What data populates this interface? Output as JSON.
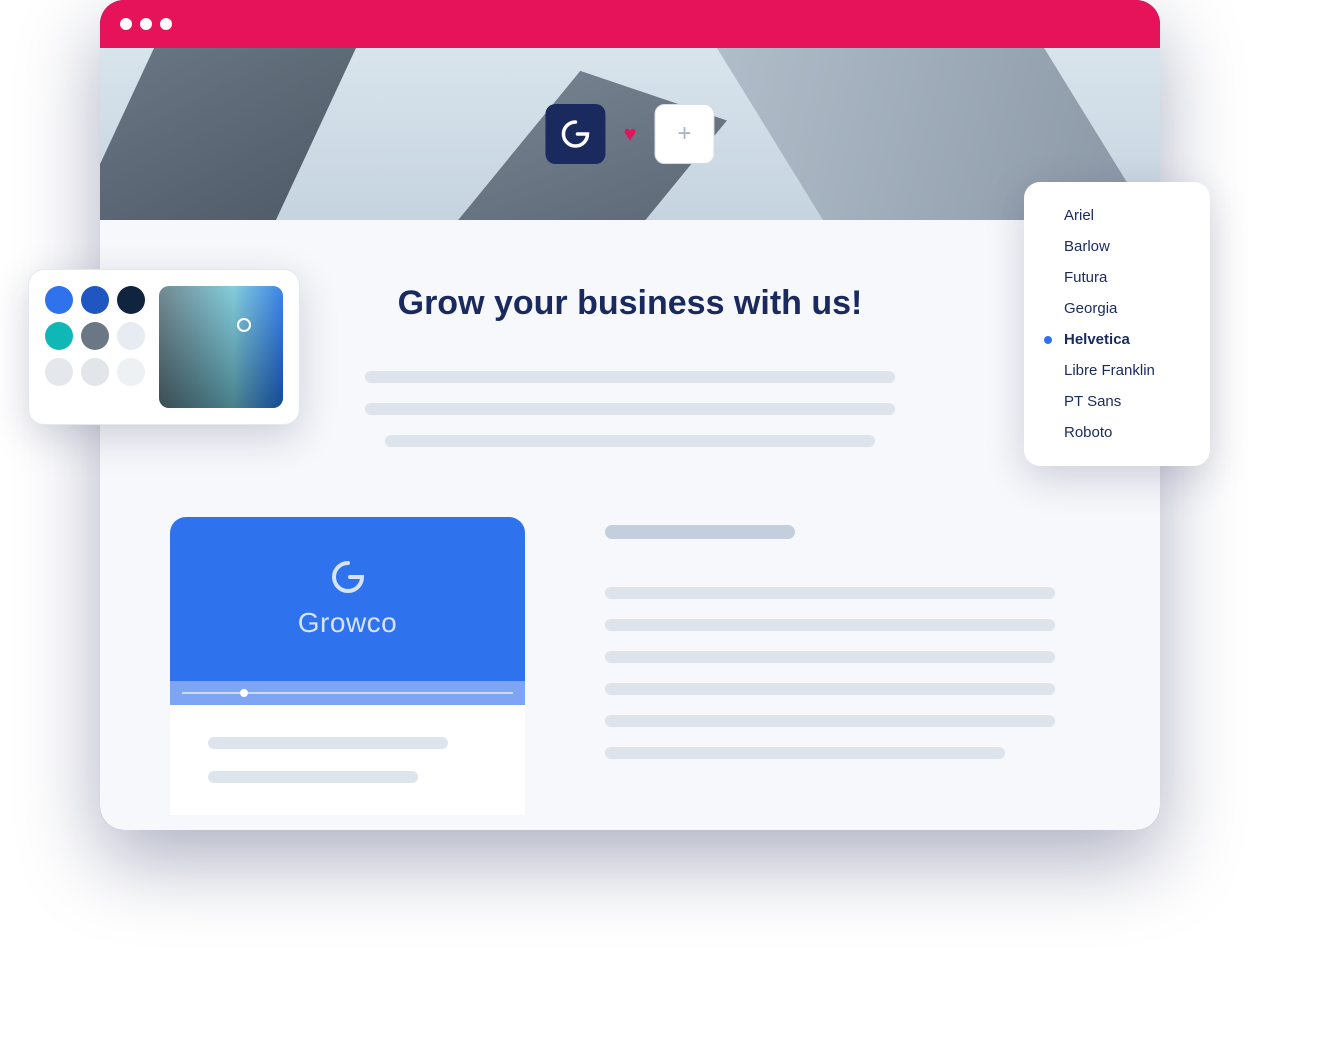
{
  "hero": {
    "logo_name": "G",
    "add_icon": "+",
    "heart_icon": "♥"
  },
  "content": {
    "headline": "Grow your business with us!"
  },
  "card": {
    "brand_name": "Growco"
  },
  "color_picker": {
    "swatches": [
      "#2f72ee",
      "#1f56c2",
      "#0f253f",
      "#10b7b7",
      "#6b7785",
      "#e7ecf2",
      "#e4e8ec",
      "#e2e6ea",
      "#eef1f4"
    ]
  },
  "font_dropdown": {
    "options": [
      {
        "label": "Ariel",
        "selected": false
      },
      {
        "label": "Barlow",
        "selected": false
      },
      {
        "label": "Futura",
        "selected": false
      },
      {
        "label": "Georgia",
        "selected": false
      },
      {
        "label": "Helvetica",
        "selected": true
      },
      {
        "label": "Libre Franklin",
        "selected": false
      },
      {
        "label": "PT Sans",
        "selected": false
      },
      {
        "label": "Roboto",
        "selected": false
      }
    ]
  }
}
